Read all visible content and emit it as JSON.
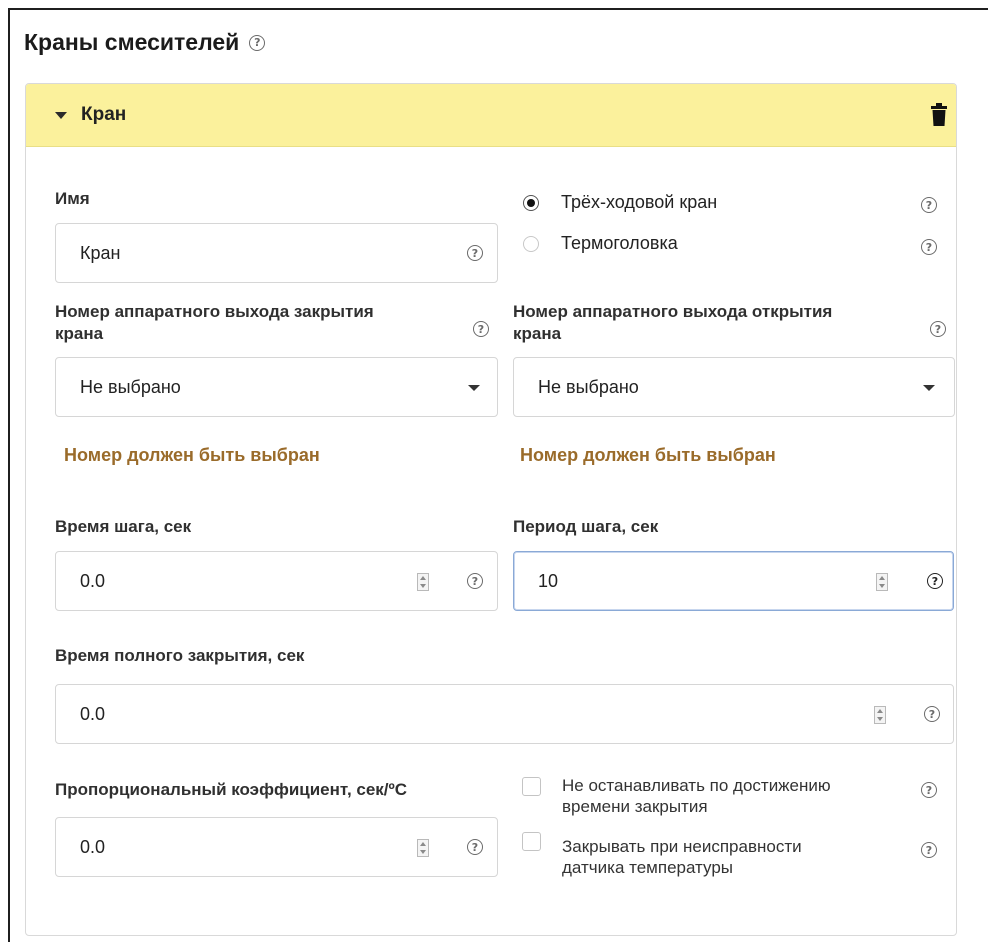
{
  "section": {
    "title": "Краны смесителей"
  },
  "card": {
    "title": "Кран"
  },
  "name_field": {
    "label": "Имя",
    "value": "Кран"
  },
  "valve_type": {
    "options": [
      {
        "label": "Трёх-ходовой кран",
        "selected": true
      },
      {
        "label": "Термоголовка",
        "selected": false
      }
    ]
  },
  "close_output": {
    "label_line1": "Номер аппаратного выхода закрытия",
    "label_line2": "крана",
    "value": "Не выбрано",
    "warning": "Номер должен быть выбран"
  },
  "open_output": {
    "label_line1": "Номер аппаратного выхода открытия",
    "label_line2": "крана",
    "value": "Не выбрано",
    "warning": "Номер должен быть выбран"
  },
  "step_time": {
    "label": "Время шага, сек",
    "value": "0.0"
  },
  "step_period": {
    "label": "Период шага, сек",
    "value": "10"
  },
  "full_close_time": {
    "label": "Время полного закрытия, сек",
    "value": "0.0"
  },
  "prop_coef": {
    "label": "Пропорциональный коэффициент, сек/ºC",
    "value": "0.0"
  },
  "checkboxes": {
    "no_stop": {
      "line1": "Не останавливать по достижению",
      "line2": "времени закрытия",
      "checked": false
    },
    "close_on_fault": {
      "line1": "Закрывать при неисправности",
      "line2": "датчика температуры",
      "checked": false
    }
  },
  "icons": {
    "help": "help-circle-icon",
    "delete": "trash-icon",
    "collapse": "caret-down-icon",
    "select": "caret-down-icon",
    "spinner": "spinner-icon"
  },
  "colors": {
    "header_bg": "#fbf19c",
    "warning": "#9a6b2a",
    "focus_border": "#8aa9d6"
  }
}
